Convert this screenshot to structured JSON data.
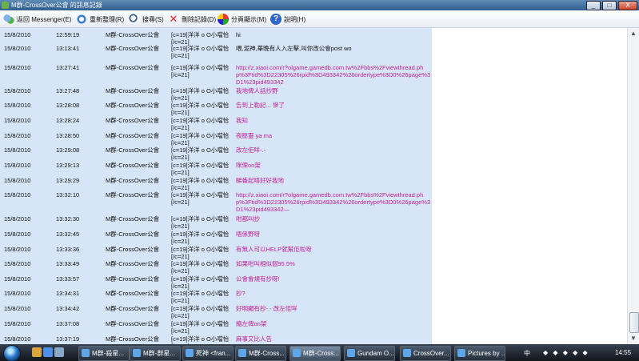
{
  "window": {
    "title": "M群-CrossOver公會 的訊息記錄",
    "controls": [
      "_",
      "□",
      "X"
    ]
  },
  "toolbar": {
    "back": "返回 Messenger(E)",
    "refresh": "重新整理(R)",
    "search": "搜尋(S)",
    "delete": "刪除記錄(D)",
    "split": "分頁顯示(M)",
    "help": "說明(H)"
  },
  "rows": [
    {
      "date": "15/8/2010",
      "time": "12:59:19",
      "sender": "M群-CrossOver公會",
      "user1": "[c=19]洋洋 o O小噹恰",
      "user2": "[/c=21]",
      "msg": "hi",
      "style": "plain"
    },
    {
      "date": "15/8/2010",
      "time": "13:13:41",
      "sender": "M群-CrossOver公會",
      "user1": "[c=19]洋洋 o O小噹恰",
      "user2": "[/c=21]",
      "msg": "喂,泥神,華晚有人入左擊,叫你改公會post wo",
      "style": "plain"
    },
    {
      "date": "15/8/2010",
      "time": "13:27:41",
      "sender": "M群-CrossOver公會",
      "user1": "[c=19]洋洋 o O小噹恰",
      "user2": "[/c=21]",
      "msg": "http://z.xiaoi.com/r?olgame.gamedb.com.tw%2Fbbs%2Fviewthread.php%3Ftid%3D22305%26rpid%3D493342%26ordertype%3D0%26page%3D1%23pid493342",
      "style": "pink"
    },
    {
      "date": "15/8/2010",
      "time": "13:27:48",
      "sender": "M群-CrossOver公會",
      "user1": "[c=19]洋洋 o O小噹恰",
      "user2": "[/c=21]",
      "msg": "我地俾人話抄野",
      "style": "pink"
    },
    {
      "date": "15/8/2010",
      "time": "13:28:08",
      "sender": "M群-CrossOver公會",
      "user1": "[c=19]洋洋 o O小噹恰",
      "user2": "[/c=21]",
      "msg": "告到上勒記... 慘了",
      "style": "pink"
    },
    {
      "date": "15/8/2010",
      "time": "13:28:24",
      "sender": "M群-CrossOver公會",
      "user1": "[c=19]洋洋 o O小噹恰",
      "user2": "[/c=21]",
      "msg": "我知",
      "style": "pink"
    },
    {
      "date": "15/8/2010",
      "time": "13:28:50",
      "sender": "M群-CrossOver公會",
      "user1": "[c=19]洋洋 o O小噹恰",
      "user2": "[/c=21]",
      "msg": "夜壓靈 ya ma",
      "style": "pink"
    },
    {
      "date": "15/8/2010",
      "time": "13:29:08",
      "sender": "M群-CrossOver公會",
      "user1": "[c=19]洋洋 o O小噹恰",
      "user2": "[/c=21]",
      "msg": "改左佢咩-.-",
      "style": "pink"
    },
    {
      "date": "15/8/2010",
      "time": "13:29:13",
      "sender": "M群-CrossOver公會",
      "user1": "[c=19]洋洋 o O小噹恰",
      "user2": "[/c=21]",
      "msg": "咪俾on架",
      "style": "pink"
    },
    {
      "date": "15/8/2010",
      "time": "13:29:29",
      "sender": "M群-CrossOver公會",
      "user1": "[c=19]洋洋 o O小噹恰",
      "user2": "[/c=21]",
      "msg": "睇番起唔好好我地",
      "style": "pink"
    },
    {
      "date": "15/8/2010",
      "time": "13:32:10",
      "sender": "M群-CrossOver公會",
      "user1": "[c=19]洋洋 o O小噹恰",
      "user2": "[/c=21]",
      "msg": "http://z.xiaoi.com/r?olgame.gamedb.com.tw%2Fbbs%2Fviewthread.php%3Ftid%3D22305%26rpid%3D493342%26ordertype%3D0%26page%3D1%23pid493342—",
      "style": "pink"
    },
    {
      "date": "15/8/2010",
      "time": "13:32:30",
      "sender": "M群-CrossOver公會",
      "user1": "[c=19]洋洋 o O小噹恰",
      "user2": "[/c=21]",
      "msg": "咁都叫抄",
      "style": "pink"
    },
    {
      "date": "15/8/2010",
      "time": "13:32:45",
      "sender": "M群-CrossOver公會",
      "user1": "[c=19]洋洋 o O小噹恰",
      "user2": "[/c=21]",
      "msg": "唔係野呀",
      "style": "pink"
    },
    {
      "date": "15/8/2010",
      "time": "13:33:36",
      "sender": "M群-CrossOver公會",
      "user1": "[c=19]洋洋 o O小噹恰",
      "user2": "[/c=21]",
      "msg": "有無人可以HELP就幫佢啦呀",
      "style": "pink"
    },
    {
      "date": "15/8/2010",
      "time": "13:33:49",
      "sender": "M群-CrossOver公會",
      "user1": "[c=19]洋洋 o O小噹恰",
      "user2": "[/c=21]",
      "msg": "如果咁叫相似個95.5%",
      "style": "pink"
    },
    {
      "date": "15/8/2010",
      "time": "13:33:57",
      "sender": "M群-CrossOver公會",
      "user1": "[c=19]洋洋 o O小噹恰",
      "user2": "[/c=21]",
      "msg": "公會會規有抄呀!",
      "style": "pink"
    },
    {
      "date": "15/8/2010",
      "time": "13:34:31",
      "sender": "M群-CrossOver公會",
      "user1": "[c=19]洋洋 o O小噹恰",
      "user2": "[/c=21]",
      "msg": "抄?",
      "style": "pink"
    },
    {
      "date": "15/8/2010",
      "time": "13:34:42",
      "sender": "M群-CrossOver公會",
      "user1": "[c=19]洋洋 o O小噹恰",
      "user2": "[/c=21]",
      "msg": "好明顯有抄-.- 改左佢咩",
      "style": "pink"
    },
    {
      "date": "15/8/2010",
      "time": "13:37:08",
      "sender": "M群-CrossOver公會",
      "user1": "[c=19]洋洋 o O小噹恰",
      "user2": "[/c=21]",
      "msg": "縮左俾on架",
      "style": "pink"
    },
    {
      "date": "15/8/2010",
      "time": "13:37:19",
      "sender": "M群-CrossOver公會",
      "user1": "[c=19]洋洋 o O小噹恰",
      "user2": "[/c=21]",
      "msg": "麻事又比人告",
      "style": "pink"
    }
  ],
  "taskbar": {
    "tasks": [
      "M群-殺星...",
      "M群-群星...",
      "死神 <fran...",
      "M群-Cross...",
      "M群-Cross...",
      "Gundam O...",
      "CrossOver...",
      "Pictures by ..."
    ],
    "active_index": 4,
    "clock": "14:55",
    "lang": "中"
  },
  "colors": {
    "pink": "#c0209a",
    "log_bg": "#d6e6f8"
  }
}
